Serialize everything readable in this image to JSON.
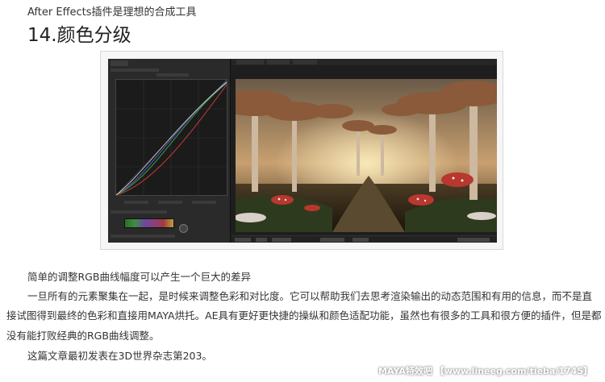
{
  "article": {
    "pre_title": "After Effects插件是理想的合成工具",
    "section_title": "14.颜色分级",
    "paragraphs": [
      "简单的调整RGB曲线幅度可以产生一个巨大的差异",
      "一旦所有的元素聚集在一起，是时候来调整色彩和对比度。它可以帮助我们去思考渲染输出的动态范围和有用的信息，而不是直",
      "接试图得到最终的色彩和直接用MAYA烘托。AE具有更好更快捷的操纵和颜色适配功能，虽然也有很多的工具和很方便的插件，但是都",
      "没有能打败经典的RGB曲线调整。",
      "这篇文章最初发表在3D世界杂志第203。"
    ]
  },
  "watermark": "MAYA特效吧 【www.lineeg.com/tieba/1745】",
  "colors": {
    "curve_red": "#c23a3a",
    "curve_green": "#3aa03a",
    "curve_blue": "#5a5ad0",
    "curve_master": "#e0e0e0"
  }
}
